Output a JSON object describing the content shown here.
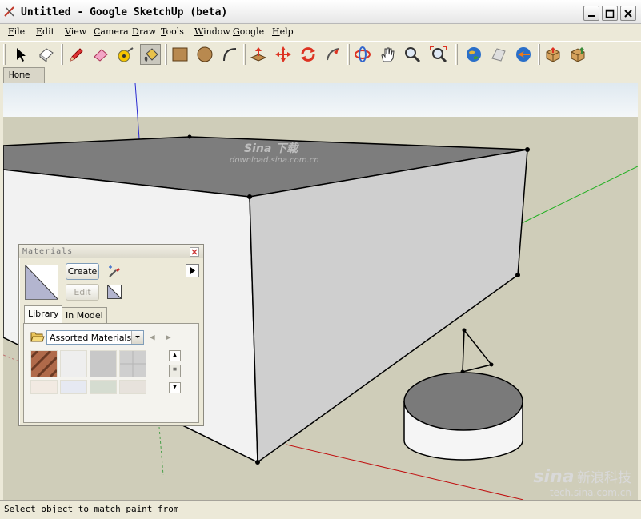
{
  "window": {
    "title": "Untitled - Google SketchUp (beta)"
  },
  "menu": [
    "File",
    "Edit",
    "View",
    "Camera",
    "Draw",
    "Tools",
    "Window",
    "Google",
    "Help"
  ],
  "toolbar": {
    "tools": [
      "select-icon",
      "eraser-component-icon",
      "pencil-icon",
      "eraser-icon",
      "tape-measure-icon",
      "paint-bucket-icon",
      "rectangle-icon",
      "circle-icon",
      "arc-icon",
      "push-pull-icon",
      "move-icon",
      "rotate-icon",
      "follow-me-icon",
      "orbit-icon",
      "pan-icon",
      "zoom-icon",
      "zoom-extents-icon",
      "google-earth-icon",
      "get-terrain-icon",
      "place-model-icon",
      "get-models-icon",
      "share-model-icon"
    ],
    "active_tool": "paint-bucket-icon"
  },
  "scene_tabs": {
    "home": "Home"
  },
  "watermarks": {
    "top_logo": "Sina 下载",
    "top_url": "download.sina.com.cn",
    "bottom_logo": "sina",
    "bottom_cn": "新浪科技",
    "bottom_url": "tech.sina.com.cn"
  },
  "materials": {
    "title": "Materials",
    "create_label": "Create",
    "edit_label": "Edit",
    "tabs": {
      "library": "Library",
      "in_model": "In Model"
    },
    "selected_library": "Assorted Materials",
    "swatch_colors": [
      "#b06a4a",
      "#eeeeee",
      "#c8c8c8",
      "#cfcfcf",
      "#f2eae2",
      "#e6e9f2",
      "#d5dcd0",
      "#e7e2dc"
    ]
  },
  "status": {
    "text": "Select object to match paint from"
  }
}
